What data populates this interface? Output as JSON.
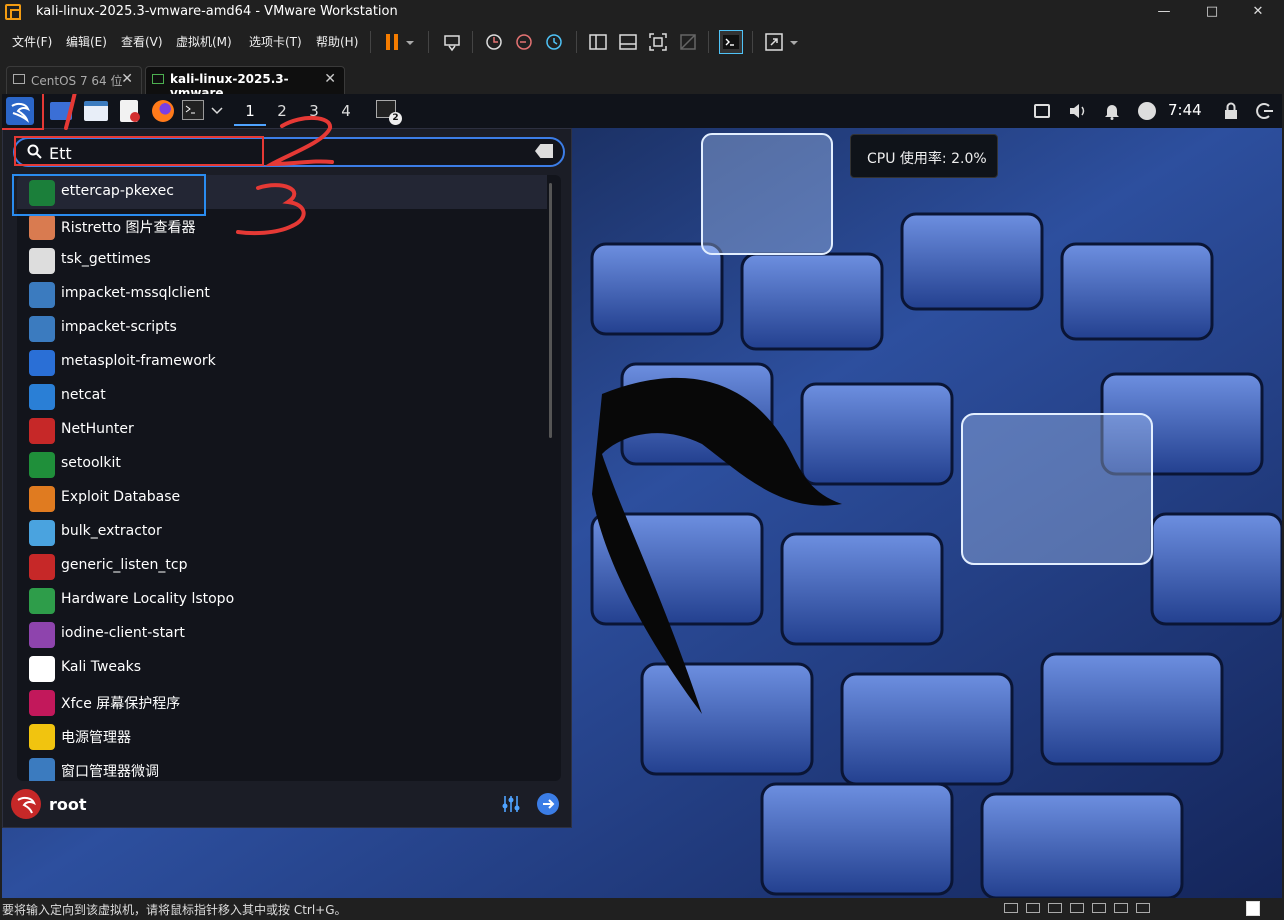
{
  "window": {
    "title": "kali-linux-2025.3-vmware-amd64 - VMware Workstation"
  },
  "menubar": {
    "items": [
      "文件(F)",
      "编辑(E)",
      "查看(V)",
      "虚拟机(M)",
      "选项卡(T)",
      "帮助(H)"
    ]
  },
  "tabs": [
    {
      "label": "CentOS 7 64 位"
    },
    {
      "label": "kali-linux-2025.3-vmware..."
    }
  ],
  "panel": {
    "workspaces": [
      "1",
      "2",
      "3",
      "4"
    ],
    "terminal_badge": "2",
    "clock": "7:44"
  },
  "tooltip": {
    "text": "CPU 使用率: 2.0%"
  },
  "search": {
    "value": "Ett"
  },
  "apps": [
    {
      "label": "ettercap-pkexec",
      "icon": "ettercap-icon",
      "color": "#1b7f3a"
    },
    {
      "label": "Ristretto 图片查看器",
      "icon": "ristretto-icon",
      "color": "#d97b50"
    },
    {
      "label": "tsk_gettimes",
      "icon": "disk-icon",
      "color": "#dddddd"
    },
    {
      "label": "impacket-mssqlclient",
      "icon": "python-icon",
      "color": "#3b7bbf"
    },
    {
      "label": "impacket-scripts",
      "icon": "python-icon",
      "color": "#3b7bbf"
    },
    {
      "label": "metasploit-framework",
      "icon": "metasploit-icon",
      "color": "#2a6fd6"
    },
    {
      "label": "netcat",
      "icon": "netcat-icon",
      "color": "#2a7fd6"
    },
    {
      "label": "NetHunter",
      "icon": "nethunter-icon",
      "color": "#c62828"
    },
    {
      "label": "setoolkit",
      "icon": "setoolkit-icon",
      "color": "#1f8f3a"
    },
    {
      "label": "Exploit Database",
      "icon": "spider-icon",
      "color": "#e07b20"
    },
    {
      "label": "bulk_extractor",
      "icon": "extractor-icon",
      "color": "#4aa3df"
    },
    {
      "label": "generic_listen_tcp",
      "icon": "spike-icon",
      "color": "#c62828"
    },
    {
      "label": "Hardware Locality lstopo",
      "icon": "chip-icon",
      "color": "#2e9d4a"
    },
    {
      "label": "iodine-client-start",
      "icon": "iodine-icon",
      "color": "#8e44ad"
    },
    {
      "label": "Kali Tweaks",
      "icon": "kali-icon",
      "color": "#ffffff"
    },
    {
      "label": "Xfce 屏幕保护程序",
      "icon": "lock-icon",
      "color": "#c2185b"
    },
    {
      "label": "电源管理器",
      "icon": "power-icon",
      "color": "#f1c40f"
    },
    {
      "label": "窗口管理器微调",
      "icon": "window-icon",
      "color": "#3b7bbf"
    }
  ],
  "user": {
    "name": "root"
  },
  "status": {
    "text": "要将输入定向到该虚拟机，请将鼠标指针移入其中或按 Ctrl+G。"
  },
  "annotations": [
    "1",
    "2",
    "3"
  ]
}
